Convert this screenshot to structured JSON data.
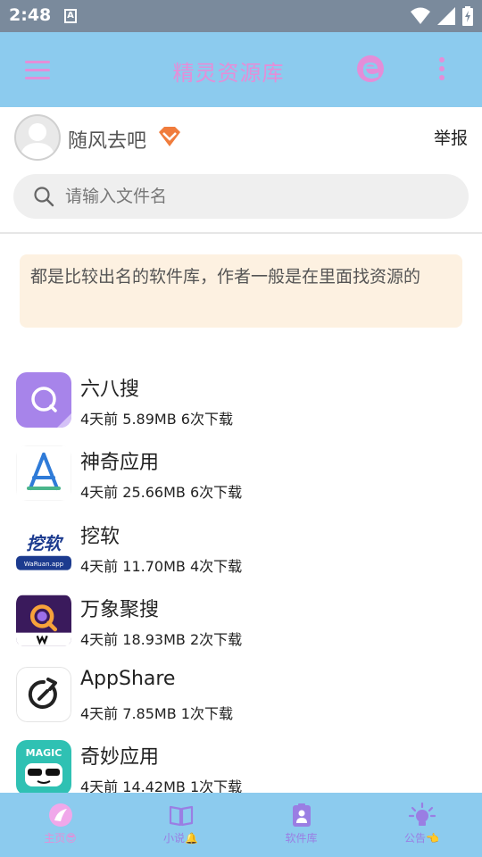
{
  "status": {
    "time": "2:48",
    "a_icon": "A"
  },
  "app_bar": {
    "title": "精灵资源库"
  },
  "user": {
    "name": "随风去吧",
    "report": "举报"
  },
  "search": {
    "placeholder": "请输入文件名"
  },
  "notice": "都是比较出名的软件库，作者一般是在里面找资源的",
  "files": [
    {
      "name": "六八搜",
      "meta": "4天前 5.89MB 6次下载",
      "icon": "sixeight-search-icon"
    },
    {
      "name": "神奇应用",
      "meta": "4天前 25.66MB 6次下载",
      "icon": "magic-app-icon"
    },
    {
      "name": "挖软",
      "meta": "4天前 11.70MB 4次下载",
      "icon": "waruan-icon",
      "icon_text": "挖软",
      "icon_sub": "WaRuan.app"
    },
    {
      "name": "万象聚搜",
      "meta": "4天前 18.93MB 2次下载",
      "icon": "wanxiang-search-icon"
    },
    {
      "name": "AppShare",
      "meta": "4天前 7.85MB 1次下载",
      "icon": "appshare-icon"
    },
    {
      "name": "奇妙应用",
      "meta": "4天前 14.42MB 1次下载",
      "icon": "qimiao-app-icon",
      "icon_text": "MAGIC"
    }
  ],
  "nav": [
    {
      "label": "主页😎",
      "icon": "home-icon",
      "active": true
    },
    {
      "label": "小说🔔",
      "icon": "book-icon"
    },
    {
      "label": "软件库",
      "icon": "software-library-icon"
    },
    {
      "label": "公告👈",
      "icon": "announcement-icon"
    }
  ],
  "colors": {
    "app_bar": "#8ccbee",
    "accent_pink": "#e48ed8",
    "accent_purple": "#9a7ee3",
    "notice_bg": "#fdf1e1"
  }
}
